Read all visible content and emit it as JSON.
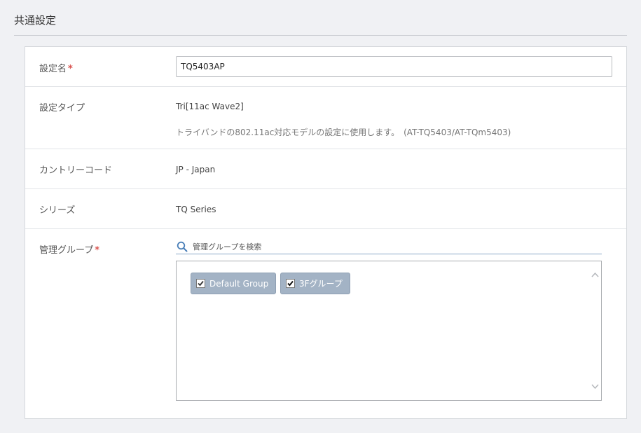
{
  "section": {
    "title": "共通設定"
  },
  "form": {
    "name": {
      "label": "設定名",
      "required_mark": "*",
      "value": "TQ5403AP"
    },
    "type": {
      "label": "設定タイプ",
      "value": "Tri[11ac Wave2]",
      "description": "トライバンドの802.11ac対応モデルの設定に使用します。",
      "models": "(AT-TQ5403/AT-TQm5403)"
    },
    "country": {
      "label": "カントリーコード",
      "value": "JP - Japan"
    },
    "series": {
      "label": "シリーズ",
      "value": "TQ Series"
    },
    "groups": {
      "label": "管理グループ",
      "required_mark": "*",
      "search_placeholder": "管理グループを検索",
      "items": [
        {
          "label": "Default Group",
          "checked": true
        },
        {
          "label": "3Fグループ",
          "checked": true
        }
      ]
    }
  },
  "colors": {
    "required": "#d9534f",
    "chip_bg": "#a3b3c5",
    "search_underline": "#8aa7c8",
    "page_bg": "#f0f1f4"
  },
  "icons": {
    "search": "search-icon",
    "scroll_up": "chevron-up-icon",
    "scroll_down": "chevron-down-icon",
    "checkbox": "checkbox-checked-icon"
  }
}
